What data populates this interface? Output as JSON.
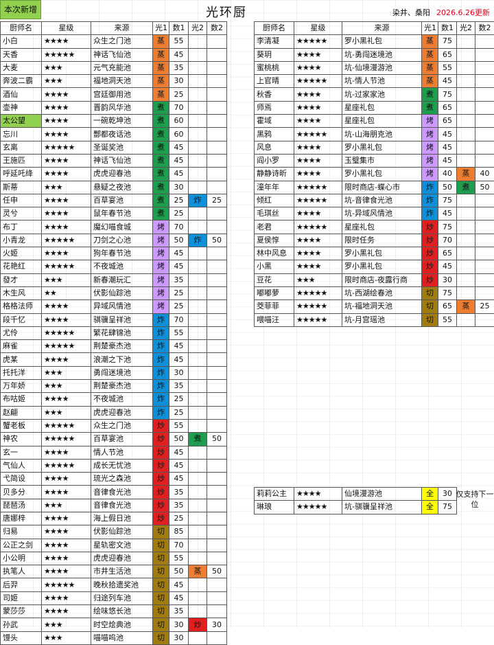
{
  "header": {
    "new_badge": "本次新增",
    "title": "光环厨",
    "authors": "染井、桑阳",
    "update": "2026.6.26更新"
  },
  "columns": [
    "厨师名",
    "星级",
    "来源",
    "光1",
    "数1",
    "光2",
    "数2"
  ],
  "method_colors": {
    "蒸": "#ed7d31",
    "煮": "#1e9d4f",
    "烤": "#cc99ff",
    "炸": "#0f8fd8",
    "炒": "#e02020",
    "切": "#a07c10",
    "全": "#ffff00"
  },
  "left_rows": [
    [
      "小白",
      "★★★★",
      "众生之门池",
      "蒸",
      "55",
      "",
      ""
    ],
    [
      "天香",
      "★★★★★",
      "神话飞仙池",
      "蒸",
      "45",
      "",
      ""
    ],
    [
      "大麦",
      "★★★",
      "元气充能池",
      "蒸",
      "35",
      "",
      ""
    ],
    [
      "奔波二霸",
      "★★★",
      "福地洞天池",
      "蒸",
      "30",
      "",
      ""
    ],
    [
      "酒仙",
      "★★★★",
      "宫廷御用池",
      "蒸",
      "25",
      "",
      ""
    ],
    [
      "壶神",
      "★★★★",
      "晋韵风华池",
      "煮",
      "70",
      "",
      ""
    ],
    [
      "太公望",
      "★★★★",
      "一碗乾坤池",
      "煮",
      "60",
      "",
      ""
    ],
    [
      "忘川",
      "★★★★",
      "酆都夜话池",
      "煮",
      "60",
      "",
      ""
    ],
    [
      "玄离",
      "★★★★★",
      "圣诞奖池",
      "煮",
      "45",
      "",
      ""
    ],
    [
      "王施匹",
      "★★★★",
      "神话飞仙池",
      "煮",
      "45",
      "",
      ""
    ],
    [
      "呼延吒绛",
      "★★★★",
      "虎虎迎春池",
      "煮",
      "45",
      "",
      ""
    ],
    [
      "斯蒂",
      "★★★",
      "悬疑之夜池",
      "煮",
      "30",
      "",
      ""
    ],
    [
      "任申",
      "★★★★",
      "百草宴池",
      "煮",
      "25",
      "炸",
      "25"
    ],
    [
      "灵兮",
      "★★★★",
      "鼠年春节池",
      "煮",
      "25",
      "",
      ""
    ],
    [
      "布丁",
      "★★★★",
      "魔幻喵食城",
      "烤",
      "70",
      "",
      ""
    ],
    [
      "小青龙",
      "★★★★★",
      "刀剑之心池",
      "烤",
      "50",
      "炸",
      "50"
    ],
    [
      "火姬",
      "★★★★",
      "狗年春节池",
      "烤",
      "45",
      "",
      ""
    ],
    [
      "花艳红",
      "★★★★★",
      "不夜城池",
      "烤",
      "45",
      "",
      ""
    ],
    [
      "發才",
      "★★★",
      "新春潮玩汇",
      "烤",
      "35",
      "",
      ""
    ],
    [
      "木生风",
      "★★",
      "伏影仙踪池",
      "烤",
      "25",
      "",
      ""
    ],
    [
      "格格法师",
      "★★★★",
      "异域风情池",
      "烤",
      "25",
      "",
      ""
    ],
    [
      "段千忆",
      "★★★★",
      "骐骥呈祥池",
      "炸",
      "70",
      "",
      ""
    ],
    [
      "尤伶",
      "★★★★★",
      "繁花肆锦池",
      "炸",
      "55",
      "",
      ""
    ],
    [
      "麻雀",
      "★★★★★",
      "荆楚豪杰池",
      "炸",
      "45",
      "",
      ""
    ],
    [
      "虎某",
      "★★★★",
      "浪潮之下池",
      "炸",
      "45",
      "",
      ""
    ],
    [
      "托托洋",
      "★★★",
      "勇闯迷境池",
      "炸",
      "30",
      "",
      ""
    ],
    [
      "万年娇",
      "★★★",
      "荆楚豪杰池",
      "炸",
      "35",
      "",
      ""
    ],
    [
      "布咕姬",
      "★★★★",
      "不夜城池",
      "炸",
      "25",
      "",
      ""
    ],
    [
      "赵翩",
      "★★★",
      "虎虎迎春池",
      "炸",
      "25",
      "",
      ""
    ],
    [
      "蟹老板",
      "★★★★★",
      "众生之门池",
      "炒",
      "55",
      "",
      ""
    ],
    [
      "神农",
      "★★★★★",
      "百草宴池",
      "炒",
      "50",
      "煮",
      "50"
    ],
    [
      "玄一",
      "★★★★",
      "情人节池",
      "炒",
      "45",
      "",
      ""
    ],
    [
      "气仙人",
      "★★★★★",
      "成长无忧池",
      "炒",
      "45",
      "",
      ""
    ],
    [
      "弋简设",
      "★★★★",
      "琉光之森池",
      "炒",
      "45",
      "",
      ""
    ],
    [
      "贝多分",
      "★★★★",
      "音律食光池",
      "炒",
      "35",
      "",
      ""
    ],
    [
      "琵琶汤",
      "★★★",
      "音律食光池",
      "炒",
      "35",
      "",
      ""
    ],
    [
      "唐娜梓",
      "★★★★",
      "海上假日池",
      "炒",
      "25",
      "",
      ""
    ],
    [
      "归易",
      "★★★★",
      "伏影仙踪池",
      "切",
      "85",
      "",
      ""
    ],
    [
      "公正之剑",
      "★★★★",
      "星轨密文池",
      "切",
      "70",
      "",
      ""
    ],
    [
      "小公明",
      "★★★★",
      "虎虎迎春池",
      "切",
      "55",
      "",
      ""
    ],
    [
      "执笔人",
      "★★★★",
      "市井生活池",
      "切",
      "50",
      "蒸",
      "50"
    ],
    [
      "后羿",
      "★★★★★",
      "晚秋拾遗奖池",
      "切",
      "45",
      "",
      ""
    ],
    [
      "司姬",
      "★★★★",
      "归途列车池",
      "切",
      "45",
      "",
      ""
    ],
    [
      "蒙莎莎",
      "★★★★",
      "绘味悠长池",
      "切",
      "35",
      "",
      ""
    ],
    [
      "孙武",
      "★★★",
      "时空烩典池",
      "切",
      "30",
      "炒",
      "30"
    ],
    [
      "馒头",
      "★★★",
      "喵喵呜池",
      "切",
      "30",
      "",
      ""
    ]
  ],
  "right_rows": [
    [
      "李清凝",
      "★★★★★",
      "罗小黑礼包",
      "蒸",
      "75",
      "",
      ""
    ],
    [
      "葵玥",
      "★★★★",
      "坑-勇闯迷境池",
      "蒸",
      "65",
      "",
      ""
    ],
    [
      "蜜桃桃",
      "★★★★",
      "坑-仙境漫游池",
      "蒸",
      "55",
      "",
      ""
    ],
    [
      "上官晴",
      "★★★★★",
      "坑-情人节池",
      "蒸",
      "45",
      "",
      ""
    ],
    [
      "秋香",
      "★★★★",
      "坑-过家家池",
      "煮",
      "75",
      "",
      ""
    ],
    [
      "师焉",
      "★★★★",
      "星座礼包",
      "煮",
      "65",
      "",
      ""
    ],
    [
      "霍域",
      "★★★★",
      "星座礼包",
      "烤",
      "65",
      "",
      ""
    ],
    [
      "黑鸦",
      "★★★★★",
      "坑-山海朋克池",
      "烤",
      "45",
      "",
      ""
    ],
    [
      "风息",
      "★★★★",
      "罗小黑礼包",
      "烤",
      "45",
      "",
      ""
    ],
    [
      "阎小罗",
      "★★★★",
      "玉璧集市",
      "烤",
      "45",
      "",
      ""
    ],
    [
      "静静诗昕",
      "★★★★",
      "罗小黑礼包",
      "烤",
      "40",
      "蒸",
      "40"
    ],
    [
      "潼年年",
      "★★★★★",
      "限时商店-蝶心市",
      "炸",
      "50",
      "煮",
      "50"
    ],
    [
      "倾红",
      "★★★★★",
      "坑-音律食光池",
      "炸",
      "75",
      "",
      ""
    ],
    [
      "毛琪丝",
      "★★★★",
      "坑-异域风情池",
      "炸",
      "45",
      "",
      ""
    ],
    [
      "老君",
      "★★★★★",
      "星座礼包",
      "炒",
      "75",
      "",
      ""
    ],
    [
      "夏侯惇",
      "★★★★",
      "限时任务",
      "炒",
      "70",
      "",
      ""
    ],
    [
      "林中风息",
      "★★★★",
      "罗小黑礼包",
      "炒",
      "65",
      "",
      ""
    ],
    [
      "小黑",
      "★★★★",
      "罗小黑礼包",
      "炒",
      "45",
      "",
      ""
    ],
    [
      "豆花",
      "★★★",
      "限时商店-夜露行商",
      "炒",
      "30",
      "",
      ""
    ],
    [
      "嘟嘟萝",
      "★★★★★",
      "坑-西湖绘春池",
      "切",
      "75",
      "",
      ""
    ],
    [
      "茭菲菲",
      "★★★★★",
      "坑-福地洞天池",
      "切",
      "65",
      "蒸",
      "25"
    ],
    [
      "喂喵汪",
      "★★★★★",
      "坑-月宫瑶池",
      "切",
      "55",
      "",
      ""
    ]
  ],
  "special_rows": [
    [
      "莉莉公主",
      "★★★★",
      "仙境漫游池",
      "全",
      "30"
    ],
    [
      "琳琅",
      "★★★★★",
      "坑-骐骥呈祥池",
      "全",
      "75"
    ]
  ],
  "special_note": "仅支持下一位",
  "highlighted_chef": "太公望"
}
